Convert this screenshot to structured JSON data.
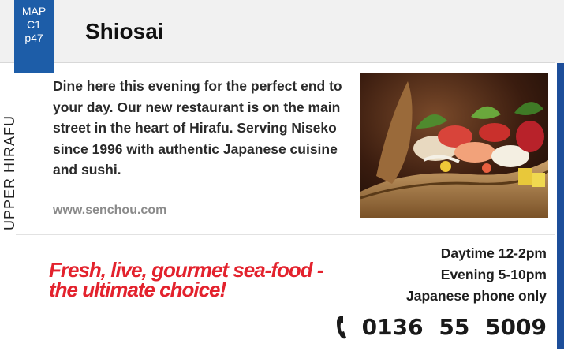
{
  "map_badge": {
    "line1": "MAP",
    "line2": "C1",
    "line3": "p47"
  },
  "restaurant": {
    "name": "Shiosai"
  },
  "area": {
    "label": "UPPER HIRAFU"
  },
  "description": "Dine here this evening for the perfect end to your day. Our new restaurant is on the main street in the heart of Hirafu. Serving Niseko since 1996 with authentic Japanese cuisine and sushi.",
  "website": "www.senchou.com",
  "photo": {
    "subject": "sashimi-boat-photo"
  },
  "slogan": "Fresh, live, gourmet sea-food - the ultimate choice!",
  "hours": {
    "daytime": "Daytime 12-2pm",
    "evening": "Evening 5-10pm",
    "note": "Japanese phone only"
  },
  "contact": {
    "phone_icon": "phone-handset-icon",
    "phone": "0136 55 5009"
  },
  "colors": {
    "badge_blue": "#1d5da8",
    "edge_blue": "#1d4e9a",
    "slogan_red": "#e3222d",
    "header_bg": "#f1f1f1"
  }
}
